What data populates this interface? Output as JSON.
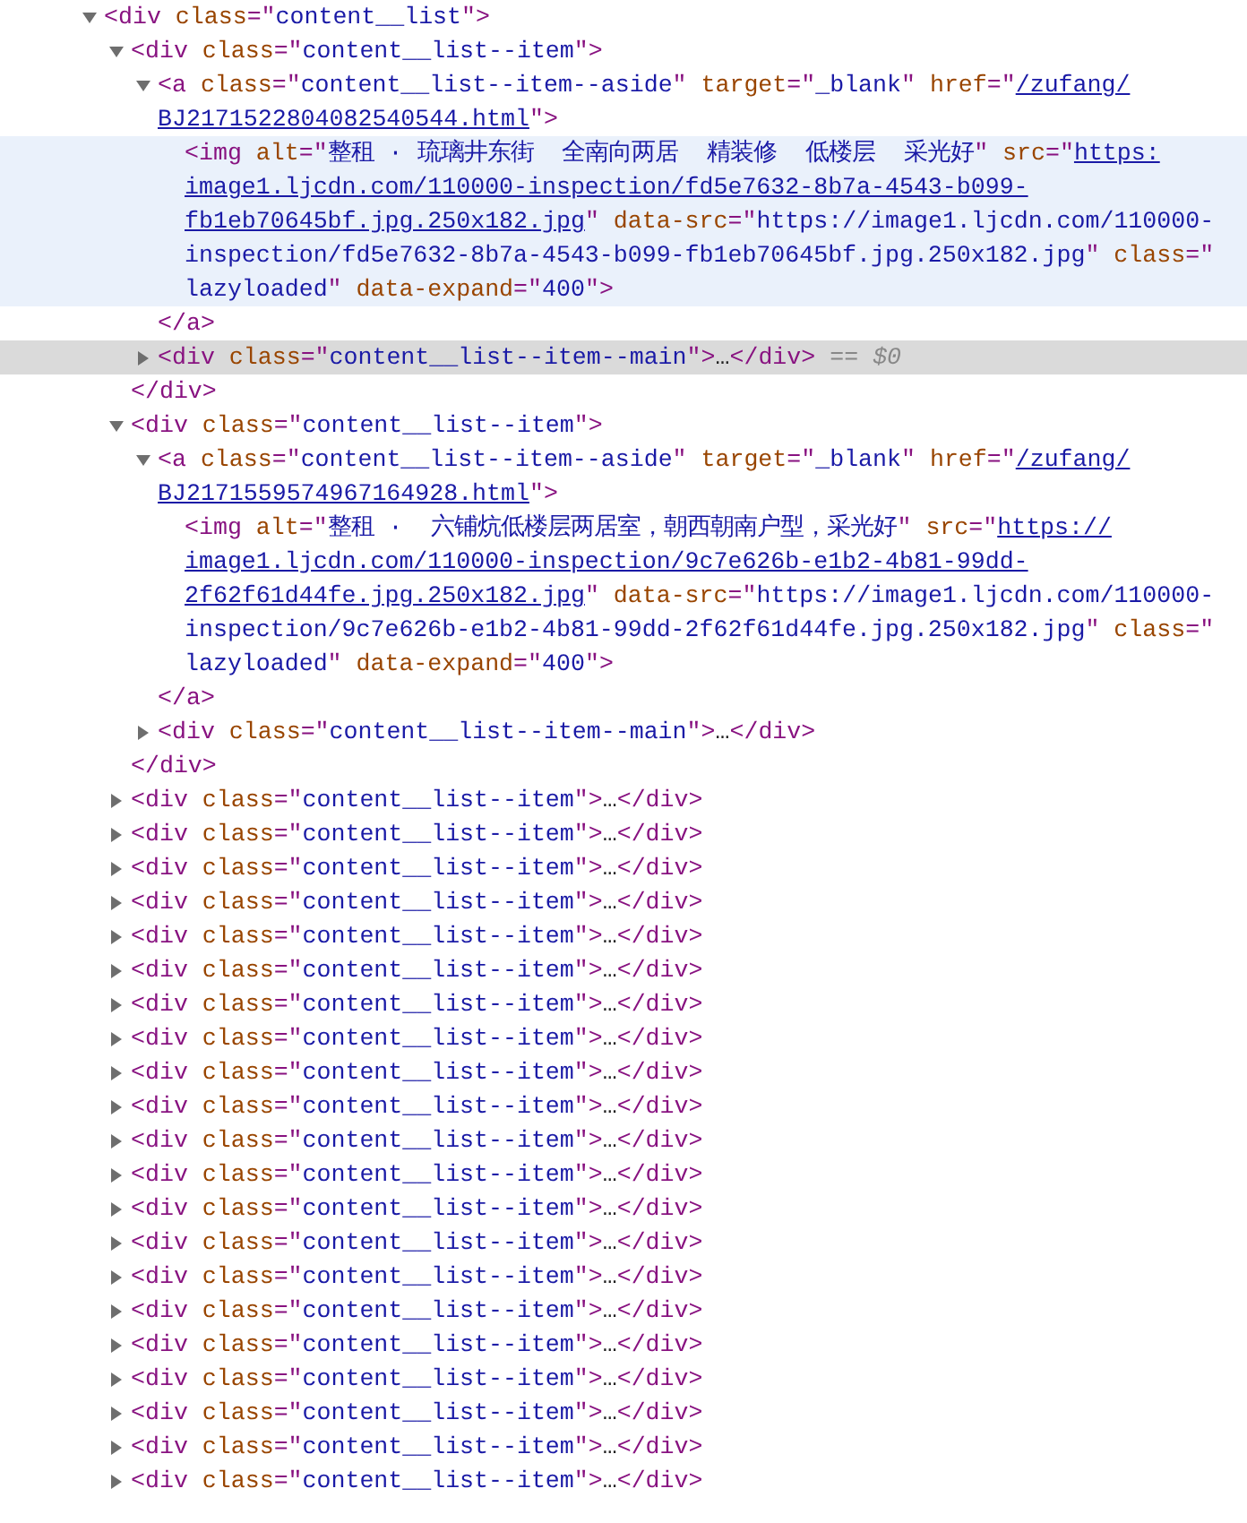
{
  "elements_tree": [
    {
      "lines": [
        [
          {
            "kind": "tag",
            "text": "<div"
          },
          {
            "kind": "attr",
            "text": " class"
          },
          {
            "kind": "tag",
            "text": "=\""
          },
          {
            "kind": "value",
            "text": "content__list"
          },
          {
            "kind": "tag",
            "text": "\">"
          }
        ]
      ],
      "expanded": true,
      "selected": false,
      "hovered": false,
      "children": [
        {
          "lines": [
            [
              {
                "kind": "tag",
                "text": "<div"
              },
              {
                "kind": "attr",
                "text": " class"
              },
              {
                "kind": "tag",
                "text": "=\""
              },
              {
                "kind": "value",
                "text": "content__list--item"
              },
              {
                "kind": "tag",
                "text": "\">"
              }
            ]
          ],
          "expanded": true,
          "selected": false,
          "hovered": false,
          "children": [
            {
              "lines": [
                [
                  {
                    "kind": "tag",
                    "text": "<a"
                  },
                  {
                    "kind": "attr",
                    "text": " class"
                  },
                  {
                    "kind": "tag",
                    "text": "=\""
                  },
                  {
                    "kind": "value",
                    "text": "content__list--item--aside"
                  },
                  {
                    "kind": "tag",
                    "text": "\""
                  },
                  {
                    "kind": "attr",
                    "text": " target"
                  },
                  {
                    "kind": "tag",
                    "text": "=\""
                  },
                  {
                    "kind": "value",
                    "text": "_blank"
                  },
                  {
                    "kind": "tag",
                    "text": "\""
                  },
                  {
                    "kind": "attr",
                    "text": " href"
                  },
                  {
                    "kind": "tag",
                    "text": "=\""
                  },
                  {
                    "kind": "link",
                    "text": "/zufang/"
                  }
                ],
                [
                  {
                    "kind": "link",
                    "text": "BJ2171522804082540544.html"
                  },
                  {
                    "kind": "tag",
                    "text": "\">"
                  }
                ]
              ],
              "expanded": true,
              "selected": false,
              "hovered": false,
              "children": [
                {
                  "lines": [
                    [
                      {
                        "kind": "tag",
                        "text": "<img"
                      },
                      {
                        "kind": "attr",
                        "text": " alt"
                      },
                      {
                        "kind": "tag",
                        "text": "=\""
                      },
                      {
                        "kind": "value",
                        "text": "整租 · 琉璃井东街  全南向两居  精装修  低楼层  采光好"
                      },
                      {
                        "kind": "tag",
                        "text": "\""
                      },
                      {
                        "kind": "attr",
                        "text": " src"
                      },
                      {
                        "kind": "tag",
                        "text": "=\""
                      },
                      {
                        "kind": "link",
                        "text": "https:"
                      }
                    ],
                    [
                      {
                        "kind": "link",
                        "text": "image1.ljcdn.com/110000-inspection/fd5e7632-8b7a-4543-b099-"
                      }
                    ],
                    [
                      {
                        "kind": "link",
                        "text": "fb1eb70645bf.jpg.250x182.jpg"
                      },
                      {
                        "kind": "tag",
                        "text": "\""
                      },
                      {
                        "kind": "attr",
                        "text": " data-src"
                      },
                      {
                        "kind": "tag",
                        "text": "=\""
                      },
                      {
                        "kind": "value",
                        "text": "https://image1.ljcdn.com/110000-"
                      }
                    ],
                    [
                      {
                        "kind": "value",
                        "text": "inspection/fd5e7632-8b7a-4543-b099-fb1eb70645bf.jpg.250x182.jpg"
                      },
                      {
                        "kind": "tag",
                        "text": "\""
                      },
                      {
                        "kind": "attr",
                        "text": " class"
                      },
                      {
                        "kind": "tag",
                        "text": "=\""
                      }
                    ],
                    [
                      {
                        "kind": "value",
                        "text": "lazyloaded"
                      },
                      {
                        "kind": "tag",
                        "text": "\""
                      },
                      {
                        "kind": "attr",
                        "text": " data-expand"
                      },
                      {
                        "kind": "tag",
                        "text": "=\""
                      },
                      {
                        "kind": "value",
                        "text": "400"
                      },
                      {
                        "kind": "tag",
                        "text": "\">"
                      }
                    ]
                  ],
                  "selected": false,
                  "hovered": true
                }
              ],
              "close": [
                {
                  "kind": "tag",
                  "text": "</a>"
                }
              ]
            },
            {
              "lines": [
                [
                  {
                    "kind": "tag",
                    "text": "<div"
                  },
                  {
                    "kind": "attr",
                    "text": " class"
                  },
                  {
                    "kind": "tag",
                    "text": "=\""
                  },
                  {
                    "kind": "value",
                    "text": "content__list--item--main"
                  },
                  {
                    "kind": "tag",
                    "text": "\">"
                  },
                  {
                    "kind": "plain",
                    "text": "…"
                  },
                  {
                    "kind": "tag",
                    "text": "</div>"
                  },
                  {
                    "kind": "ref",
                    "text": "== $0"
                  }
                ]
              ],
              "expanded": false,
              "selected": true,
              "hovered": false
            }
          ],
          "close": [
            {
              "kind": "tag",
              "text": "</div>"
            }
          ]
        },
        {
          "lines": [
            [
              {
                "kind": "tag",
                "text": "<div"
              },
              {
                "kind": "attr",
                "text": " class"
              },
              {
                "kind": "tag",
                "text": "=\""
              },
              {
                "kind": "value",
                "text": "content__list--item"
              },
              {
                "kind": "tag",
                "text": "\">"
              }
            ]
          ],
          "expanded": true,
          "selected": false,
          "hovered": false,
          "children": [
            {
              "lines": [
                [
                  {
                    "kind": "tag",
                    "text": "<a"
                  },
                  {
                    "kind": "attr",
                    "text": " class"
                  },
                  {
                    "kind": "tag",
                    "text": "=\""
                  },
                  {
                    "kind": "value",
                    "text": "content__list--item--aside"
                  },
                  {
                    "kind": "tag",
                    "text": "\""
                  },
                  {
                    "kind": "attr",
                    "text": " target"
                  },
                  {
                    "kind": "tag",
                    "text": "=\""
                  },
                  {
                    "kind": "value",
                    "text": "_blank"
                  },
                  {
                    "kind": "tag",
                    "text": "\""
                  },
                  {
                    "kind": "attr",
                    "text": " href"
                  },
                  {
                    "kind": "tag",
                    "text": "=\""
                  },
                  {
                    "kind": "link",
                    "text": "/zufang/"
                  }
                ],
                [
                  {
                    "kind": "link",
                    "text": "BJ2171559574967164928.html"
                  },
                  {
                    "kind": "tag",
                    "text": "\">"
                  }
                ]
              ],
              "expanded": true,
              "selected": false,
              "hovered": false,
              "children": [
                {
                  "lines": [
                    [
                      {
                        "kind": "tag",
                        "text": "<img"
                      },
                      {
                        "kind": "attr",
                        "text": " alt"
                      },
                      {
                        "kind": "tag",
                        "text": "=\""
                      },
                      {
                        "kind": "value",
                        "text": "整租 ·  六铺炕低楼层两居室，朝西朝南户型，采光好"
                      },
                      {
                        "kind": "tag",
                        "text": "\""
                      },
                      {
                        "kind": "attr",
                        "text": " src"
                      },
                      {
                        "kind": "tag",
                        "text": "=\""
                      },
                      {
                        "kind": "link",
                        "text": "https://"
                      }
                    ],
                    [
                      {
                        "kind": "link",
                        "text": "image1.ljcdn.com/110000-inspection/9c7e626b-e1b2-4b81-99dd-"
                      }
                    ],
                    [
                      {
                        "kind": "link",
                        "text": "2f62f61d44fe.jpg.250x182.jpg"
                      },
                      {
                        "kind": "tag",
                        "text": "\""
                      },
                      {
                        "kind": "attr",
                        "text": " data-src"
                      },
                      {
                        "kind": "tag",
                        "text": "=\""
                      },
                      {
                        "kind": "value",
                        "text": "https://image1.ljcdn.com/110000-"
                      }
                    ],
                    [
                      {
                        "kind": "value",
                        "text": "inspection/9c7e626b-e1b2-4b81-99dd-2f62f61d44fe.jpg.250x182.jpg"
                      },
                      {
                        "kind": "tag",
                        "text": "\""
                      },
                      {
                        "kind": "attr",
                        "text": " class"
                      },
                      {
                        "kind": "tag",
                        "text": "=\""
                      }
                    ],
                    [
                      {
                        "kind": "value",
                        "text": "lazyloaded"
                      },
                      {
                        "kind": "tag",
                        "text": "\""
                      },
                      {
                        "kind": "attr",
                        "text": " data-expand"
                      },
                      {
                        "kind": "tag",
                        "text": "=\""
                      },
                      {
                        "kind": "value",
                        "text": "400"
                      },
                      {
                        "kind": "tag",
                        "text": "\">"
                      }
                    ]
                  ],
                  "selected": false,
                  "hovered": false
                }
              ],
              "close": [
                {
                  "kind": "tag",
                  "text": "</a>"
                }
              ]
            },
            {
              "lines": [
                [
                  {
                    "kind": "tag",
                    "text": "<div"
                  },
                  {
                    "kind": "attr",
                    "text": " class"
                  },
                  {
                    "kind": "tag",
                    "text": "=\""
                  },
                  {
                    "kind": "value",
                    "text": "content__list--item--main"
                  },
                  {
                    "kind": "tag",
                    "text": "\">"
                  },
                  {
                    "kind": "plain",
                    "text": "…"
                  },
                  {
                    "kind": "tag",
                    "text": "</div>"
                  }
                ]
              ],
              "expanded": false,
              "selected": false,
              "hovered": false
            }
          ],
          "close": [
            {
              "kind": "tag",
              "text": "</div>"
            }
          ]
        },
        {
          "lines": [
            [
              {
                "kind": "tag",
                "text": "<div"
              },
              {
                "kind": "attr",
                "text": " class"
              },
              {
                "kind": "tag",
                "text": "=\""
              },
              {
                "kind": "value",
                "text": "content__list--item"
              },
              {
                "kind": "tag",
                "text": "\">"
              },
              {
                "kind": "plain",
                "text": "…"
              },
              {
                "kind": "tag",
                "text": "</div>"
              }
            ]
          ],
          "expanded": false,
          "selected": false,
          "hovered": false
        },
        {
          "lines": [
            [
              {
                "kind": "tag",
                "text": "<div"
              },
              {
                "kind": "attr",
                "text": " class"
              },
              {
                "kind": "tag",
                "text": "=\""
              },
              {
                "kind": "value",
                "text": "content__list--item"
              },
              {
                "kind": "tag",
                "text": "\">"
              },
              {
                "kind": "plain",
                "text": "…"
              },
              {
                "kind": "tag",
                "text": "</div>"
              }
            ]
          ],
          "expanded": false,
          "selected": false,
          "hovered": false
        },
        {
          "lines": [
            [
              {
                "kind": "tag",
                "text": "<div"
              },
              {
                "kind": "attr",
                "text": " class"
              },
              {
                "kind": "tag",
                "text": "=\""
              },
              {
                "kind": "value",
                "text": "content__list--item"
              },
              {
                "kind": "tag",
                "text": "\">"
              },
              {
                "kind": "plain",
                "text": "…"
              },
              {
                "kind": "tag",
                "text": "</div>"
              }
            ]
          ],
          "expanded": false,
          "selected": false,
          "hovered": false
        },
        {
          "lines": [
            [
              {
                "kind": "tag",
                "text": "<div"
              },
              {
                "kind": "attr",
                "text": " class"
              },
              {
                "kind": "tag",
                "text": "=\""
              },
              {
                "kind": "value",
                "text": "content__list--item"
              },
              {
                "kind": "tag",
                "text": "\">"
              },
              {
                "kind": "plain",
                "text": "…"
              },
              {
                "kind": "tag",
                "text": "</div>"
              }
            ]
          ],
          "expanded": false,
          "selected": false,
          "hovered": false
        },
        {
          "lines": [
            [
              {
                "kind": "tag",
                "text": "<div"
              },
              {
                "kind": "attr",
                "text": " class"
              },
              {
                "kind": "tag",
                "text": "=\""
              },
              {
                "kind": "value",
                "text": "content__list--item"
              },
              {
                "kind": "tag",
                "text": "\">"
              },
              {
                "kind": "plain",
                "text": "…"
              },
              {
                "kind": "tag",
                "text": "</div>"
              }
            ]
          ],
          "expanded": false,
          "selected": false,
          "hovered": false
        },
        {
          "lines": [
            [
              {
                "kind": "tag",
                "text": "<div"
              },
              {
                "kind": "attr",
                "text": " class"
              },
              {
                "kind": "tag",
                "text": "=\""
              },
              {
                "kind": "value",
                "text": "content__list--item"
              },
              {
                "kind": "tag",
                "text": "\">"
              },
              {
                "kind": "plain",
                "text": "…"
              },
              {
                "kind": "tag",
                "text": "</div>"
              }
            ]
          ],
          "expanded": false,
          "selected": false,
          "hovered": false
        },
        {
          "lines": [
            [
              {
                "kind": "tag",
                "text": "<div"
              },
              {
                "kind": "attr",
                "text": " class"
              },
              {
                "kind": "tag",
                "text": "=\""
              },
              {
                "kind": "value",
                "text": "content__list--item"
              },
              {
                "kind": "tag",
                "text": "\">"
              },
              {
                "kind": "plain",
                "text": "…"
              },
              {
                "kind": "tag",
                "text": "</div>"
              }
            ]
          ],
          "expanded": false,
          "selected": false,
          "hovered": false
        },
        {
          "lines": [
            [
              {
                "kind": "tag",
                "text": "<div"
              },
              {
                "kind": "attr",
                "text": " class"
              },
              {
                "kind": "tag",
                "text": "=\""
              },
              {
                "kind": "value",
                "text": "content__list--item"
              },
              {
                "kind": "tag",
                "text": "\">"
              },
              {
                "kind": "plain",
                "text": "…"
              },
              {
                "kind": "tag",
                "text": "</div>"
              }
            ]
          ],
          "expanded": false,
          "selected": false,
          "hovered": false
        },
        {
          "lines": [
            [
              {
                "kind": "tag",
                "text": "<div"
              },
              {
                "kind": "attr",
                "text": " class"
              },
              {
                "kind": "tag",
                "text": "=\""
              },
              {
                "kind": "value",
                "text": "content__list--item"
              },
              {
                "kind": "tag",
                "text": "\">"
              },
              {
                "kind": "plain",
                "text": "…"
              },
              {
                "kind": "tag",
                "text": "</div>"
              }
            ]
          ],
          "expanded": false,
          "selected": false,
          "hovered": false
        },
        {
          "lines": [
            [
              {
                "kind": "tag",
                "text": "<div"
              },
              {
                "kind": "attr",
                "text": " class"
              },
              {
                "kind": "tag",
                "text": "=\""
              },
              {
                "kind": "value",
                "text": "content__list--item"
              },
              {
                "kind": "tag",
                "text": "\">"
              },
              {
                "kind": "plain",
                "text": "…"
              },
              {
                "kind": "tag",
                "text": "</div>"
              }
            ]
          ],
          "expanded": false,
          "selected": false,
          "hovered": false
        },
        {
          "lines": [
            [
              {
                "kind": "tag",
                "text": "<div"
              },
              {
                "kind": "attr",
                "text": " class"
              },
              {
                "kind": "tag",
                "text": "=\""
              },
              {
                "kind": "value",
                "text": "content__list--item"
              },
              {
                "kind": "tag",
                "text": "\">"
              },
              {
                "kind": "plain",
                "text": "…"
              },
              {
                "kind": "tag",
                "text": "</div>"
              }
            ]
          ],
          "expanded": false,
          "selected": false,
          "hovered": false
        },
        {
          "lines": [
            [
              {
                "kind": "tag",
                "text": "<div"
              },
              {
                "kind": "attr",
                "text": " class"
              },
              {
                "kind": "tag",
                "text": "=\""
              },
              {
                "kind": "value",
                "text": "content__list--item"
              },
              {
                "kind": "tag",
                "text": "\">"
              },
              {
                "kind": "plain",
                "text": "…"
              },
              {
                "kind": "tag",
                "text": "</div>"
              }
            ]
          ],
          "expanded": false,
          "selected": false,
          "hovered": false
        },
        {
          "lines": [
            [
              {
                "kind": "tag",
                "text": "<div"
              },
              {
                "kind": "attr",
                "text": " class"
              },
              {
                "kind": "tag",
                "text": "=\""
              },
              {
                "kind": "value",
                "text": "content__list--item"
              },
              {
                "kind": "tag",
                "text": "\">"
              },
              {
                "kind": "plain",
                "text": "…"
              },
              {
                "kind": "tag",
                "text": "</div>"
              }
            ]
          ],
          "expanded": false,
          "selected": false,
          "hovered": false
        },
        {
          "lines": [
            [
              {
                "kind": "tag",
                "text": "<div"
              },
              {
                "kind": "attr",
                "text": " class"
              },
              {
                "kind": "tag",
                "text": "=\""
              },
              {
                "kind": "value",
                "text": "content__list--item"
              },
              {
                "kind": "tag",
                "text": "\">"
              },
              {
                "kind": "plain",
                "text": "…"
              },
              {
                "kind": "tag",
                "text": "</div>"
              }
            ]
          ],
          "expanded": false,
          "selected": false,
          "hovered": false
        },
        {
          "lines": [
            [
              {
                "kind": "tag",
                "text": "<div"
              },
              {
                "kind": "attr",
                "text": " class"
              },
              {
                "kind": "tag",
                "text": "=\""
              },
              {
                "kind": "value",
                "text": "content__list--item"
              },
              {
                "kind": "tag",
                "text": "\">"
              },
              {
                "kind": "plain",
                "text": "…"
              },
              {
                "kind": "tag",
                "text": "</div>"
              }
            ]
          ],
          "expanded": false,
          "selected": false,
          "hovered": false
        },
        {
          "lines": [
            [
              {
                "kind": "tag",
                "text": "<div"
              },
              {
                "kind": "attr",
                "text": " class"
              },
              {
                "kind": "tag",
                "text": "=\""
              },
              {
                "kind": "value",
                "text": "content__list--item"
              },
              {
                "kind": "tag",
                "text": "\">"
              },
              {
                "kind": "plain",
                "text": "…"
              },
              {
                "kind": "tag",
                "text": "</div>"
              }
            ]
          ],
          "expanded": false,
          "selected": false,
          "hovered": false
        },
        {
          "lines": [
            [
              {
                "kind": "tag",
                "text": "<div"
              },
              {
                "kind": "attr",
                "text": " class"
              },
              {
                "kind": "tag",
                "text": "=\""
              },
              {
                "kind": "value",
                "text": "content__list--item"
              },
              {
                "kind": "tag",
                "text": "\">"
              },
              {
                "kind": "plain",
                "text": "…"
              },
              {
                "kind": "tag",
                "text": "</div>"
              }
            ]
          ],
          "expanded": false,
          "selected": false,
          "hovered": false
        },
        {
          "lines": [
            [
              {
                "kind": "tag",
                "text": "<div"
              },
              {
                "kind": "attr",
                "text": " class"
              },
              {
                "kind": "tag",
                "text": "=\""
              },
              {
                "kind": "value",
                "text": "content__list--item"
              },
              {
                "kind": "tag",
                "text": "\">"
              },
              {
                "kind": "plain",
                "text": "…"
              },
              {
                "kind": "tag",
                "text": "</div>"
              }
            ]
          ],
          "expanded": false,
          "selected": false,
          "hovered": false
        },
        {
          "lines": [
            [
              {
                "kind": "tag",
                "text": "<div"
              },
              {
                "kind": "attr",
                "text": " class"
              },
              {
                "kind": "tag",
                "text": "=\""
              },
              {
                "kind": "value",
                "text": "content__list--item"
              },
              {
                "kind": "tag",
                "text": "\">"
              },
              {
                "kind": "plain",
                "text": "…"
              },
              {
                "kind": "tag",
                "text": "</div>"
              }
            ]
          ],
          "expanded": false,
          "selected": false,
          "hovered": false
        },
        {
          "lines": [
            [
              {
                "kind": "tag",
                "text": "<div"
              },
              {
                "kind": "attr",
                "text": " class"
              },
              {
                "kind": "tag",
                "text": "=\""
              },
              {
                "kind": "value",
                "text": "content__list--item"
              },
              {
                "kind": "tag",
                "text": "\">"
              },
              {
                "kind": "plain",
                "text": "…"
              },
              {
                "kind": "tag",
                "text": "</div>"
              }
            ]
          ],
          "expanded": false,
          "selected": false,
          "hovered": false
        },
        {
          "lines": [
            [
              {
                "kind": "tag",
                "text": "<div"
              },
              {
                "kind": "attr",
                "text": " class"
              },
              {
                "kind": "tag",
                "text": "=\""
              },
              {
                "kind": "value",
                "text": "content__list--item"
              },
              {
                "kind": "tag",
                "text": "\">"
              },
              {
                "kind": "plain",
                "text": "…"
              },
              {
                "kind": "tag",
                "text": "</div>"
              }
            ]
          ],
          "expanded": false,
          "selected": false,
          "hovered": false
        }
      ]
    }
  ]
}
